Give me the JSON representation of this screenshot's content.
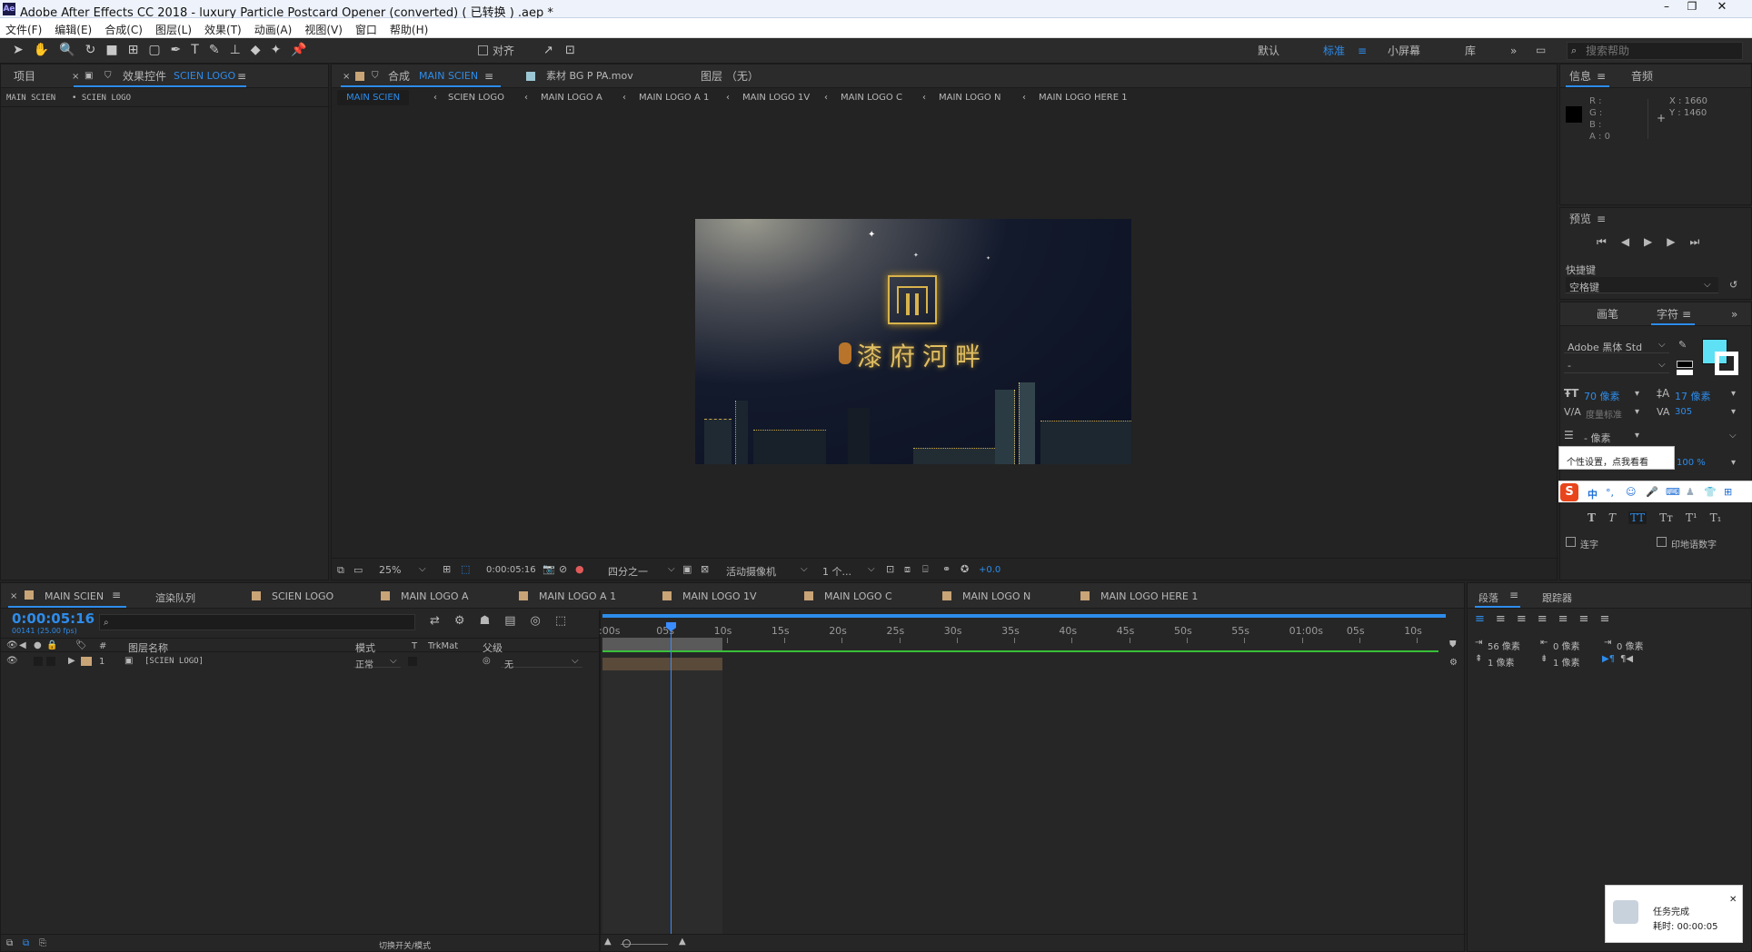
{
  "window": {
    "title": "Adobe After Effects CC 2018 - luxury Particle Postcard Opener (converted) ( 已转换 ) .aep *"
  },
  "menu": [
    "文件(F)",
    "编辑(E)",
    "合成(C)",
    "图层(L)",
    "效果(T)",
    "动画(A)",
    "视图(V)",
    "窗口",
    "帮助(H)"
  ],
  "toolbar": {
    "align_label": "对齐",
    "workspaces": [
      "默认",
      "标准",
      "小屏幕",
      "库"
    ],
    "active_workspace": "标准",
    "search_placeholder": "搜索帮助"
  },
  "project_panel": {
    "tab_project": "项目",
    "tab_effects": "效果控件",
    "effects_target": "SCIEN LOGO",
    "breadcrumb": [
      "MAIN SCIEN",
      "• SCIEN LOGO"
    ]
  },
  "viewer": {
    "comp_tab_prefix": "合成",
    "comp_name": "MAIN SCIEN",
    "footage_tab": "素材 BG P PA.mov",
    "layer_tab": "图层 （无）",
    "flow": [
      "MAIN SCIEN",
      "SCIEN LOGO",
      "MAIN LOGO A",
      "MAIN LOGO A 1",
      "MAIN LOGO 1V",
      "MAIN LOGO C",
      "MAIN LOGO N",
      "MAIN LOGO HERE 1"
    ],
    "preview_title": "漆府河畔",
    "controls": {
      "zoom": "25%",
      "timecode": "0:00:05:16",
      "resolution": "四分之一",
      "camera": "活动摄像机",
      "views": "1 个...",
      "exposure": "+0.0"
    }
  },
  "info_panel": {
    "tab_info": "信息",
    "tab_audio": "音频",
    "r": "R :",
    "g": "G :",
    "b": "B :",
    "a": "A : 0",
    "x": "X : 1660",
    "y": "Y : 1460"
  },
  "preview_panel": {
    "title": "预览",
    "shortcut_label": "快捷键",
    "shortcut_value": "空格键"
  },
  "character_panel": {
    "tab_paint": "画笔",
    "tab_character": "字符",
    "font": "Adobe 黑体 Std",
    "font_style": "-",
    "size": "70 像素",
    "leading": "17 像素",
    "kerning": "度量标准",
    "tracking": "305",
    "stroke": "- 像素",
    "scale": "100 %",
    "tooltip": "个性设置，点我看看",
    "ime_label": "中",
    "style_buttons": [
      "T",
      "T",
      "TT",
      "Tт",
      "T¹",
      "T₁"
    ],
    "ligature": "连字",
    "hindi_digits": "印地语数字",
    "fill_color": "#5ee0f5"
  },
  "timeline": {
    "tabs": [
      "MAIN SCIEN",
      "渲染队列",
      "SCIEN LOGO",
      "MAIN LOGO A",
      "MAIN LOGO A 1",
      "MAIN LOGO 1V",
      "MAIN LOGO C",
      "MAIN LOGO N",
      "MAIN LOGO HERE 1"
    ],
    "timecode": "0:00:05:16",
    "frames": "00141 (25.00 fps)",
    "columns": {
      "num": "#",
      "name": "图层名称",
      "mode": "模式",
      "t": "T",
      "trkmat": "TrkMat",
      "parent": "父级"
    },
    "layers": [
      {
        "num": "1",
        "name": "[SCIEN LOGO]",
        "mode": "正常",
        "parent": "无"
      }
    ],
    "ruler": [
      ":00s",
      "05s",
      "10s",
      "15s",
      "20s",
      "25s",
      "30s",
      "35s",
      "40s",
      "45s",
      "50s",
      "55s",
      "01:00s",
      "05s",
      "10s"
    ],
    "footer": "切换开关/模式"
  },
  "paragraph_panel": {
    "tab_paragraph": "段落",
    "tab_tracker": "跟踪器",
    "indent_left": "56 像素",
    "indent_right": "0 像素",
    "indent_first": "0 像素",
    "space_before": "1 像素",
    "space_after": "1 像素"
  },
  "notification": {
    "title": "任务完成",
    "detail": "耗时: 00:00:05"
  }
}
